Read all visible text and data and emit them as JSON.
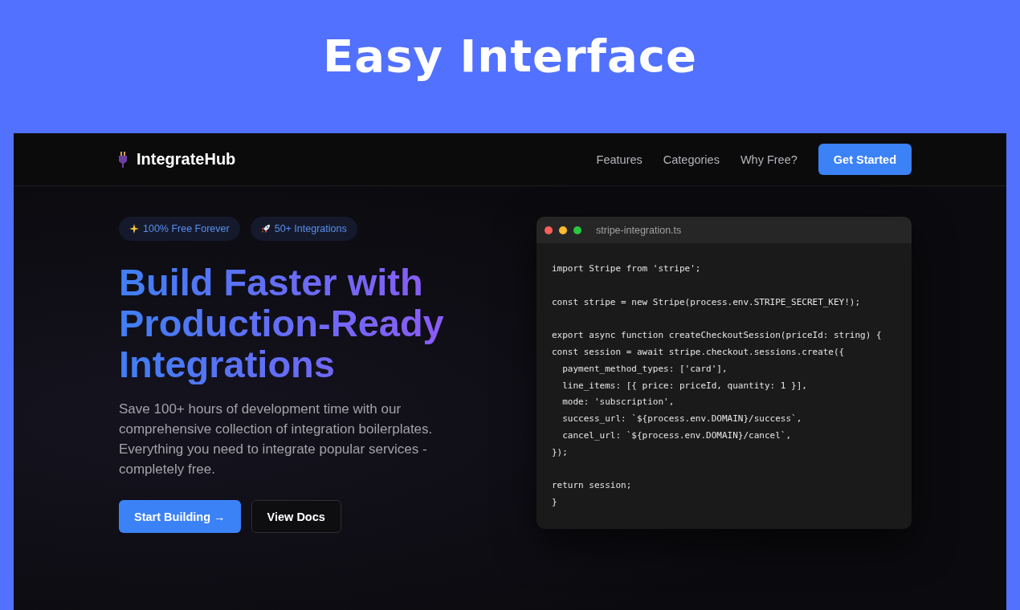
{
  "banner": {
    "title": "Easy Interface"
  },
  "nav": {
    "brand": "IntegrateHub",
    "links": [
      "Features",
      "Categories",
      "Why Free?"
    ],
    "cta": "Get Started"
  },
  "hero": {
    "badges": [
      {
        "kind": "sparkle",
        "label": "100% Free Forever"
      },
      {
        "kind": "rocket",
        "label": "50+ Integrations"
      }
    ],
    "headline": [
      "Build Faster with",
      "Production-Ready",
      "Integrations"
    ],
    "description": "Save 100+ hours of development time with our comprehensive collection of integration boilerplates. Everything you need to integrate popular services - completely free.",
    "buttons": [
      {
        "kind": "primary",
        "label": "Start Building →"
      },
      {
        "kind": "secondary",
        "label": "View Docs"
      }
    ]
  },
  "code_window": {
    "filename": "stripe-integration.ts",
    "blocks": [
      [
        "import Stripe from 'stripe';"
      ],
      [
        "const stripe = new Stripe(process.env.STRIPE_SECRET_KEY!);"
      ],
      [
        "export async function createCheckoutSession(priceId: string) {",
        "const session = await stripe.checkout.sessions.create({",
        "  payment_method_types: ['card'],",
        "  line_items: [{ price: priceId, quantity: 1 }],",
        "  mode: 'subscription',",
        "  success_url: `${process.env.DOMAIN}/success`,",
        "  cancel_url: `${process.env.DOMAIN}/cancel`,",
        "});"
      ],
      [
        "return session;",
        "}"
      ]
    ]
  }
}
